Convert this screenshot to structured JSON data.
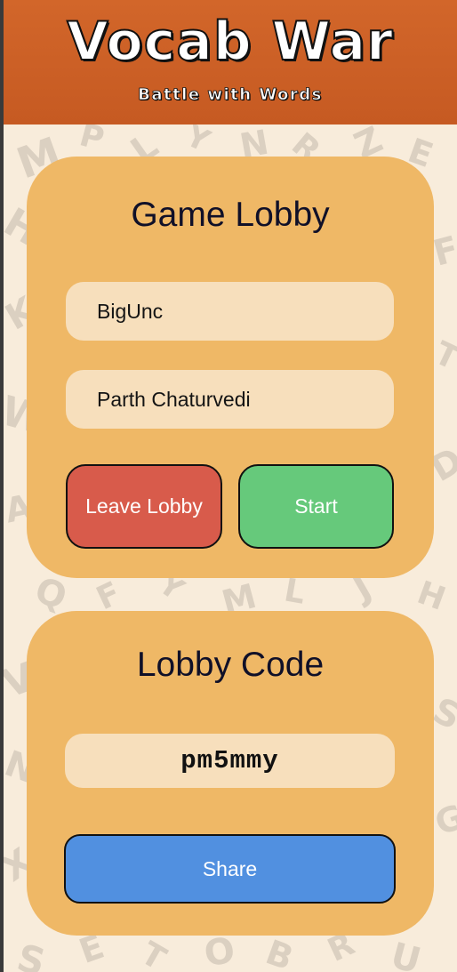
{
  "header": {
    "title": "Vocab War",
    "subtitle": "Battle with Words",
    "background_color": "#c95f26"
  },
  "lobby": {
    "title": "Game Lobby",
    "players": [
      "BigUnc",
      "Parth Chaturvedi"
    ],
    "leave_label": "Leave Lobby",
    "start_label": "Start",
    "card_color": "#efb866",
    "leave_color": "#d85b4b",
    "start_color": "#66c97b"
  },
  "code_section": {
    "title": "Lobby Code",
    "code": "pm5mmy",
    "share_label": "Share",
    "share_color": "#5190e0"
  }
}
